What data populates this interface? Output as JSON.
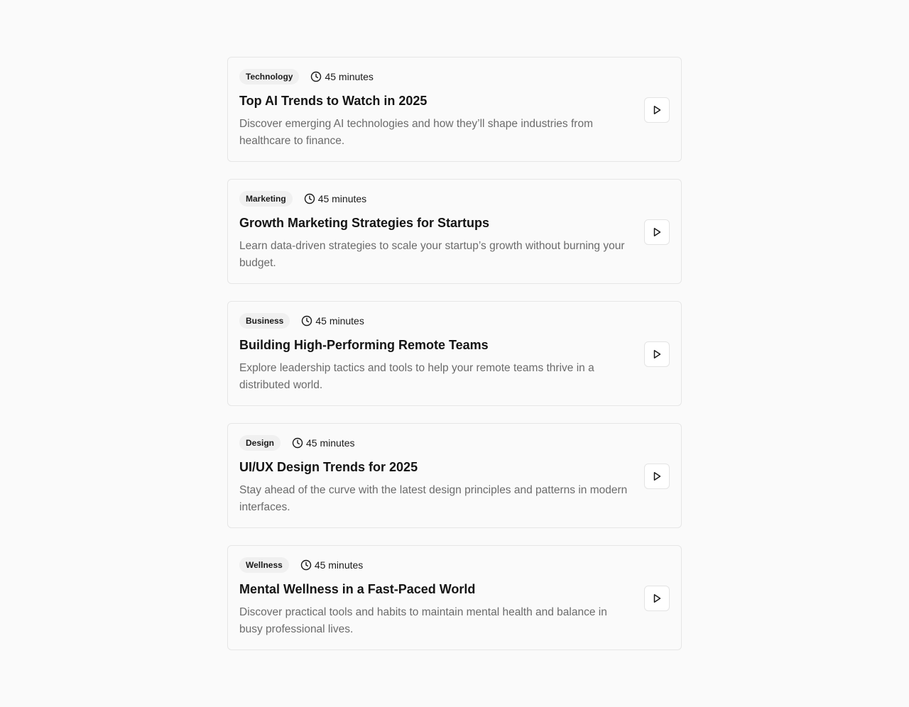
{
  "sessions": [
    {
      "category": "Technology",
      "duration": "45 minutes",
      "title": "Top AI Trends to Watch in 2025",
      "description": "Discover emerging AI technologies and how they’ll shape industries from healthcare to finance.",
      "icons": {
        "duration": "clock-icon",
        "action": "play-icon"
      }
    },
    {
      "category": "Marketing",
      "duration": "45 minutes",
      "title": "Growth Marketing Strategies for Startups",
      "description": "Learn data-driven strategies to scale your startup’s growth without burning your budget.",
      "icons": {
        "duration": "clock-icon",
        "action": "play-icon"
      }
    },
    {
      "category": "Business",
      "duration": "45 minutes",
      "title": "Building High-Performing Remote Teams",
      "description": "Explore leadership tactics and tools to help your remote teams thrive in a distributed world.",
      "icons": {
        "duration": "clock-icon",
        "action": "play-icon"
      }
    },
    {
      "category": "Design",
      "duration": "45 minutes",
      "title": "UI/UX Design Trends for 2025",
      "description": "Stay ahead of the curve with the latest design principles and patterns in modern interfaces.",
      "icons": {
        "duration": "clock-icon",
        "action": "play-icon"
      }
    },
    {
      "category": "Wellness",
      "duration": "45 minutes",
      "title": "Mental Wellness in a Fast-Paced World",
      "description": "Discover practical tools and habits to maintain mental health and balance in busy professional lives.",
      "icons": {
        "duration": "clock-icon",
        "action": "play-icon"
      }
    }
  ],
  "colors": {
    "background": "#fafafa",
    "card_border": "#e6e6e6",
    "badge_bg": "#f0f0f0",
    "title": "#141414",
    "description": "#6b6b6b"
  }
}
